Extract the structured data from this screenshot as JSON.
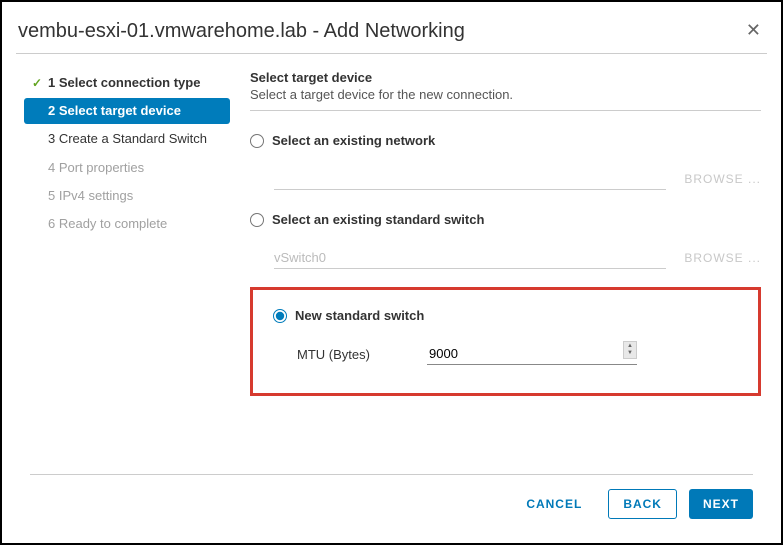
{
  "header": {
    "title": "vembu-esxi-01.vmwarehome.lab - Add Networking",
    "close": "✕"
  },
  "steps": {
    "s1": "1 Select connection type",
    "s2": "2 Select target device",
    "s3": "3 Create a Standard Switch",
    "s4": "4 Port properties",
    "s5": "5 IPv4 settings",
    "s6": "6 Ready to complete"
  },
  "main": {
    "title": "Select target device",
    "subtitle": "Select a target device for the new connection.",
    "option1": "Select an existing network",
    "option2": "Select an existing standard switch",
    "option2_value": "vSwitch0",
    "option3": "New standard switch",
    "browse": "BROWSE ...",
    "mtu_label": "MTU (Bytes)",
    "mtu_value": "9000"
  },
  "footer": {
    "cancel": "CANCEL",
    "back": "BACK",
    "next": "NEXT"
  }
}
